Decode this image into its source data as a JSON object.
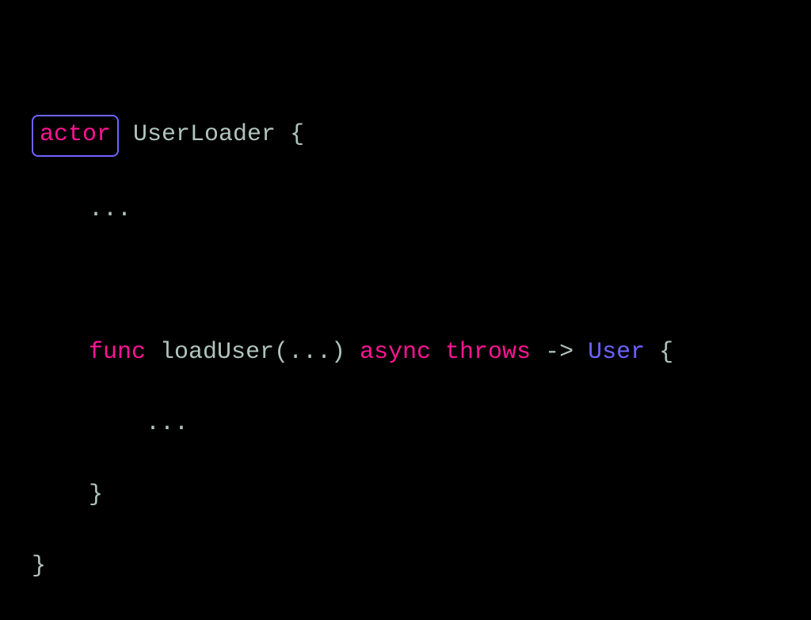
{
  "code": {
    "line1": {
      "keyword_actor": "actor",
      "class_name": " UserLoader ",
      "brace_open": "{"
    },
    "line2": {
      "indent": "    ",
      "ellipsis": "..."
    },
    "line3": {
      "blank": ""
    },
    "line4": {
      "indent": "    ",
      "keyword_func": "func",
      "space1": " ",
      "method_name": "loadUser",
      "paren_open": "(",
      "params": "...",
      "paren_close": ")",
      "space2": " ",
      "keyword_async": "async",
      "space3": " ",
      "keyword_throws": "throws",
      "space4": " ",
      "arrow": "->",
      "space5": " ",
      "return_type": "User",
      "space6": " ",
      "brace_open": "{"
    },
    "line5": {
      "indent": "        ",
      "ellipsis": "..."
    },
    "line6": {
      "indent": "    ",
      "brace_close": "}"
    },
    "line7": {
      "brace_close": "}"
    }
  }
}
